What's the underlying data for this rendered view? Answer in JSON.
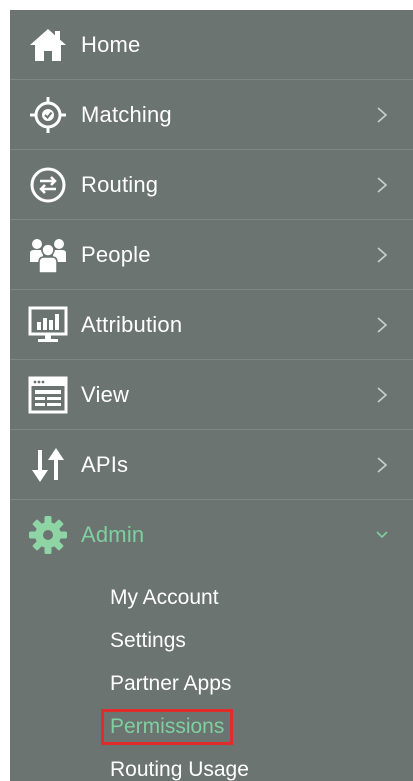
{
  "nav": {
    "items": [
      {
        "label": "Home",
        "icon": "home-icon",
        "has_chevron": false
      },
      {
        "label": "Matching",
        "icon": "target-check-icon",
        "has_chevron": true
      },
      {
        "label": "Routing",
        "icon": "route-arrows-icon",
        "has_chevron": true
      },
      {
        "label": "People",
        "icon": "people-icon",
        "has_chevron": true
      },
      {
        "label": "Attribution",
        "icon": "bar-chart-monitor-icon",
        "has_chevron": true
      },
      {
        "label": "View",
        "icon": "window-table-icon",
        "has_chevron": true
      },
      {
        "label": "APIs",
        "icon": "up-down-arrows-icon",
        "has_chevron": true
      },
      {
        "label": "Admin",
        "icon": "gear-icon",
        "has_chevron": true,
        "expanded": true
      }
    ]
  },
  "admin_submenu": {
    "items": [
      {
        "label": "My Account"
      },
      {
        "label": "Settings"
      },
      {
        "label": "Partner Apps"
      },
      {
        "label": "Permissions",
        "current": true
      },
      {
        "label": "Routing Usage"
      }
    ]
  },
  "colors": {
    "sidebar_bg": "#6b7470",
    "text": "#ffffff",
    "active": "#7fcfa0",
    "highlight": "#e12c2c"
  }
}
